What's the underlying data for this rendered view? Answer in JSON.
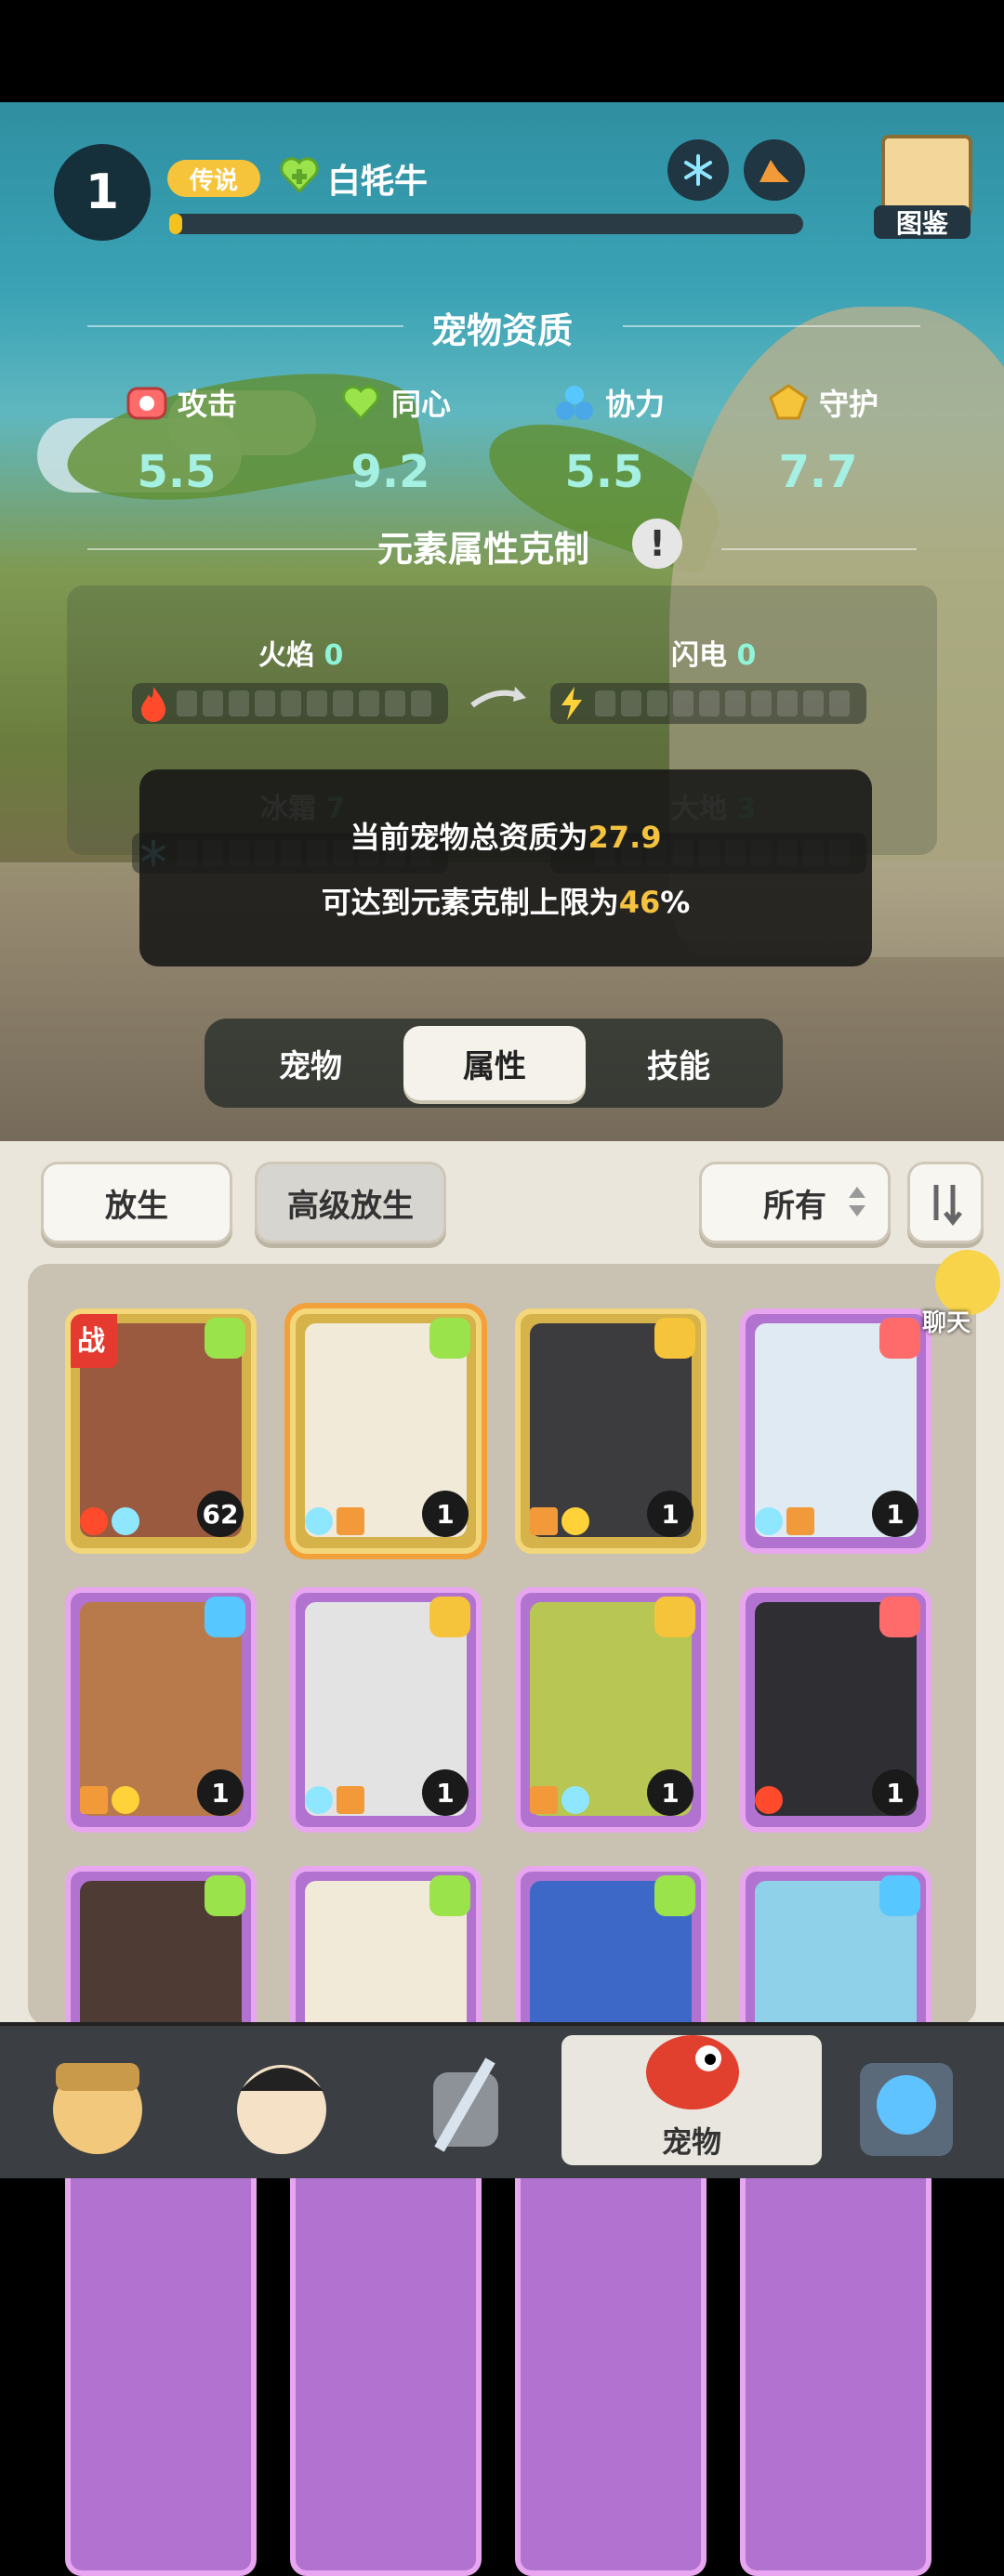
{
  "pet": {
    "level": "1",
    "rarity": "传说",
    "name": "白牦牛",
    "xp_progress": 0.02,
    "elements": [
      "snowflake-icon",
      "earth-icon"
    ]
  },
  "codex": {
    "label": "图鉴"
  },
  "aptitude": {
    "title": "宠物资质",
    "stats": [
      {
        "name": "攻击",
        "icon": "attack-icon",
        "value": "5.5"
      },
      {
        "name": "同心",
        "icon": "heart-icon",
        "value": "9.2"
      },
      {
        "name": "协力",
        "icon": "cooperation-icon",
        "value": "5.5"
      },
      {
        "name": "守护",
        "icon": "guard-icon",
        "value": "7.7"
      }
    ]
  },
  "counter": {
    "title": "元素属性克制",
    "elements": [
      {
        "name": "火焰",
        "value": "0",
        "icon": "fire-icon"
      },
      {
        "name": "闪电",
        "value": "0",
        "icon": "lightning-icon"
      },
      {
        "name": "冰霜",
        "value": "7",
        "icon": "snowflake-icon"
      },
      {
        "name": "大地",
        "value": "3",
        "icon": "earth-icon"
      }
    ]
  },
  "tooltip": {
    "line1_prefix": "当前宠物总资质为",
    "line1_value": "27.9",
    "line2_prefix": "可达到元素克制上限为",
    "line2_value": "46",
    "line2_suffix": "%"
  },
  "tabs": {
    "pet": "宠物",
    "attributes": "属性",
    "skills": "技能",
    "active": "属性"
  },
  "actions": {
    "release": "放生",
    "advanced_release": "高级放生",
    "filter": "所有"
  },
  "battle_tag": "战",
  "chat": {
    "label": "聊天"
  },
  "cards": [
    {
      "frame": "gold",
      "count": "62",
      "trait": "heart",
      "elements": [
        "fire",
        "snow"
      ],
      "battle": true
    },
    {
      "frame": "gold",
      "count": "1",
      "trait": "heart",
      "elements": [
        "snow",
        "earth"
      ],
      "selected": true
    },
    {
      "frame": "gold",
      "count": "1",
      "trait": "guard",
      "elements": [
        "earth",
        "lightning"
      ]
    },
    {
      "frame": "purple",
      "count": "1",
      "trait": "attack",
      "elements": [
        "snow",
        "earth"
      ]
    },
    {
      "frame": "purple",
      "count": "1",
      "trait": "cooperation",
      "elements": [
        "earth",
        "lightning"
      ]
    },
    {
      "frame": "purple",
      "count": "1",
      "trait": "guard",
      "elements": [
        "snow",
        "earth"
      ]
    },
    {
      "frame": "purple",
      "count": "1",
      "trait": "guard",
      "elements": [
        "earth",
        "snow"
      ]
    },
    {
      "frame": "purple",
      "count": "1",
      "trait": "attack",
      "elements": [
        "fire"
      ]
    },
    {
      "frame": "purple",
      "count": "",
      "trait": "heart",
      "elements": []
    },
    {
      "frame": "purple",
      "count": "",
      "trait": "heart",
      "elements": []
    },
    {
      "frame": "purple",
      "count": "",
      "trait": "heart",
      "elements": []
    },
    {
      "frame": "purple",
      "count": "",
      "trait": "cooperation",
      "elements": []
    }
  ],
  "nav": {
    "pet": "宠物"
  },
  "colors": {
    "accent_gold": "#f5c23f",
    "stat_value": "#a4f0e2",
    "counter_value": "#8ef4d8"
  }
}
